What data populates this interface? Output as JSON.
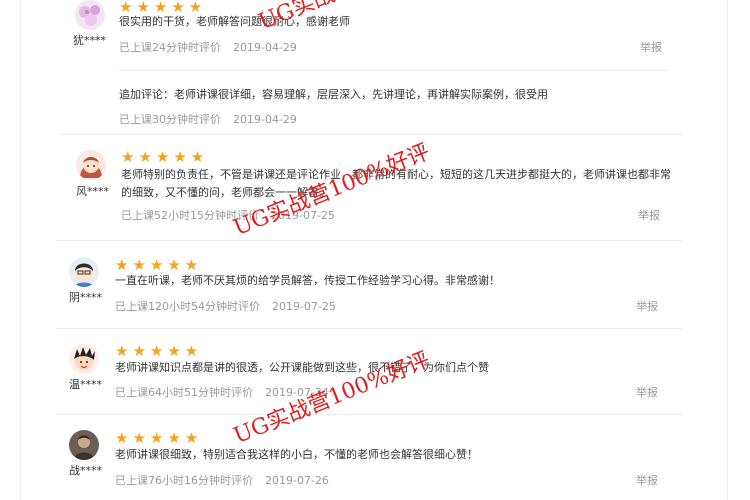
{
  "reviews": [
    {
      "username": "犹****",
      "stars": "★★★★★",
      "text": "很实用的干货，老师解答问题很耐心，感谢老师",
      "meta": "已上课24分钟时评价",
      "date": "2019-04-29",
      "report": "举报",
      "followup": {
        "text": "追加评论：老师讲课很详细，容易理解，层层深入，先讲理论，再讲解实际案例，很受用",
        "meta": "已上课30分钟时评价",
        "date": "2019-04-29"
      }
    },
    {
      "username": "风****",
      "stars": "★★★★★",
      "text": "老师特别的负责任，不管是讲课还是评论作业，都非常的有耐心，短短的这几天进步都挺大的，老师讲课也都非常的细致，又不懂的问，老师都会一一解答。",
      "meta": "已上课52小时15分钟时评价",
      "date": "2019-07-25",
      "report": "举报"
    },
    {
      "username": "阴****",
      "stars": "★★★★★",
      "text": "一直在听课，老师不厌其烦的给学员解答，传授工作经验学习心得。非常感谢！",
      "meta": "已上课120小时54分钟时评价",
      "date": "2019-07-25",
      "report": "举报"
    },
    {
      "username": "温****",
      "stars": "★★★★★",
      "text": "老师讲课知识点都是讲的很透，公开课能做到这些，很不错了，为你们点个赞",
      "meta": "已上课64小时51分钟时评价",
      "date": "2019-07-24",
      "report": "举报"
    },
    {
      "username": "战****",
      "stars": "★★★★★",
      "text": "老师讲课很细致，特别适合我这样的小白，不懂的老师也会解答很细心赞！",
      "meta": "已上课76小时16分钟时评价",
      "date": "2019-07-26",
      "report": "举报"
    }
  ],
  "watermark": "UG实战营100%好评",
  "colors": {
    "star": "#f7a21c",
    "watermark": "#e01e1e",
    "meta": "#999999"
  }
}
